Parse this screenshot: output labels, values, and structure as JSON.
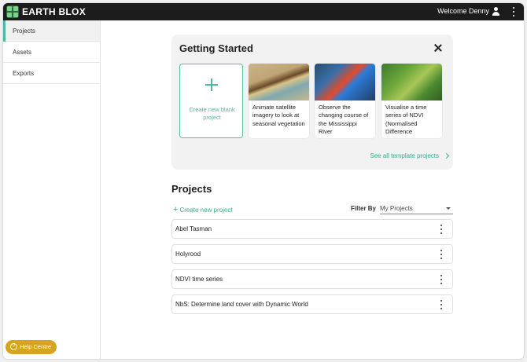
{
  "app": {
    "brand": "EARTH BLOX",
    "welcome": "Welcome Denny"
  },
  "sidebar": {
    "items": [
      {
        "label": "Projects",
        "active": true
      },
      {
        "label": "Assets",
        "active": false
      },
      {
        "label": "Exports",
        "active": false
      }
    ]
  },
  "help": {
    "label": "Help Centre"
  },
  "getting_started": {
    "title": "Getting Started",
    "blank_label": "Create new blank project",
    "templates": [
      {
        "label": "Animate satellite imagery to look at seasonal vegetation"
      },
      {
        "label": "Observe the changing course of the Mississippi River"
      },
      {
        "label": "Visualise a time series of NDVI (Normalised Difference"
      }
    ],
    "see_all": "See all template projects"
  },
  "projects": {
    "title": "Projects",
    "create_label": "Create new project",
    "filter_label": "Filter By",
    "filter_value": "My Projects",
    "items": [
      {
        "name": "Abel Tasman"
      },
      {
        "name": "Holyrood"
      },
      {
        "name": "NDVI time series"
      },
      {
        "name": "NbS: Determine land cover with Dynamic World"
      }
    ]
  },
  "colors": {
    "accent": "#4cb8a3",
    "topbar": "#1c1c1c",
    "help": "#d7a421"
  }
}
